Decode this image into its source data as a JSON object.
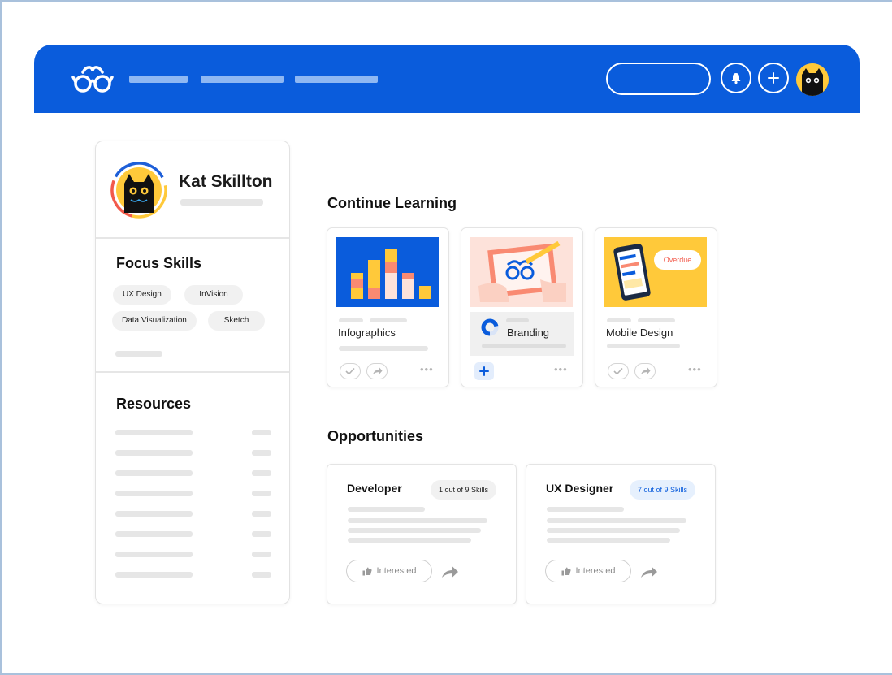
{
  "profile": {
    "name": "Kat Skillton"
  },
  "focus_skills": {
    "title": "Focus Skills",
    "skills": [
      "UX Design",
      "InVision",
      "Data Visualization",
      "Sketch"
    ]
  },
  "resources": {
    "title": "Resources"
  },
  "continue_learning": {
    "title": "Continue Learning",
    "courses": [
      {
        "label": "Infographics"
      },
      {
        "label": "Branding"
      },
      {
        "label": "Mobile Design",
        "badge": "Overdue"
      }
    ]
  },
  "opportunities": {
    "title": "Opportunities",
    "items": [
      {
        "title": "Developer",
        "skills": "1 out of 9 Skills",
        "action": "Interested"
      },
      {
        "title": "UX Designer",
        "skills": "7 out of 9 Skills",
        "action": "Interested"
      }
    ]
  },
  "colors": {
    "brand_blue": "#0a5cdc",
    "accent_yellow": "#ffc93a",
    "accent_coral": "#f25a4b"
  },
  "icons": {
    "logo": "glasses-logo-icon",
    "notifications": "bell-icon",
    "add": "plus-icon",
    "complete": "check-icon",
    "share": "share-arrow-icon",
    "more": "more-dots-icon",
    "interested": "thumbs-up-icon"
  }
}
